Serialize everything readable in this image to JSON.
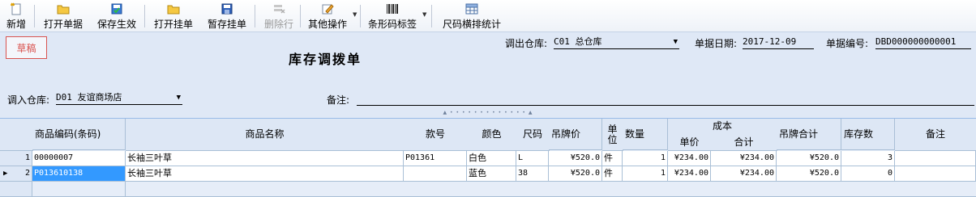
{
  "toolbar": {
    "new": "新增",
    "open_doc": "打开单据",
    "save_effective": "保存生效",
    "open_pending": "打开挂单",
    "save_pending": "暂存挂单",
    "delete_row": "删除行",
    "other_ops": "其他操作",
    "barcode_label": "条形码标签",
    "size_stats": "尺码横排统计"
  },
  "header": {
    "status": "草稿",
    "title": "库存调拨单",
    "out_warehouse_label": "调出仓库:",
    "out_warehouse_value": "C01 总仓库",
    "date_label": "单据日期:",
    "date_value": "2017-12-09",
    "docno_label": "单据编号:",
    "docno_value": "DBD000000000001",
    "in_warehouse_label": "调入仓库:",
    "in_warehouse_value": "D01 友谊商场店",
    "remark_label": "备注:",
    "remark_value": ""
  },
  "grid": {
    "columns": {
      "code": "商品编码(条码)",
      "name": "商品名称",
      "style": "款号",
      "color": "颜色",
      "size": "尺码",
      "tag_price": "吊牌价",
      "unit": "单\n位",
      "qty": "数量",
      "cost": "成本",
      "cost_unit": "单价",
      "cost_total": "合计",
      "tag_total": "吊牌合计",
      "stock": "库存数",
      "remark": "备注"
    },
    "rows": [
      {
        "idx": "1",
        "code": "00000007",
        "name": "长袖三叶草",
        "style": "P01361",
        "color": "白色",
        "size": "L",
        "tag_price": "¥520.0",
        "unit": "件",
        "qty": "1",
        "cost_unit": "¥234.00",
        "cost_total": "¥234.00",
        "tag_total": "¥520.0",
        "stock": "3",
        "remark": ""
      },
      {
        "idx": "2",
        "code": "P013610138",
        "name": "长袖三叶草",
        "style": "",
        "color": "蓝色",
        "size": "38",
        "tag_price": "¥520.0",
        "unit": "件",
        "qty": "1",
        "cost_unit": "¥234.00",
        "cost_total": "¥234.00",
        "tag_total": "¥520.0",
        "stock": "0",
        "remark": ""
      }
    ],
    "current_row_marker": "▶"
  }
}
